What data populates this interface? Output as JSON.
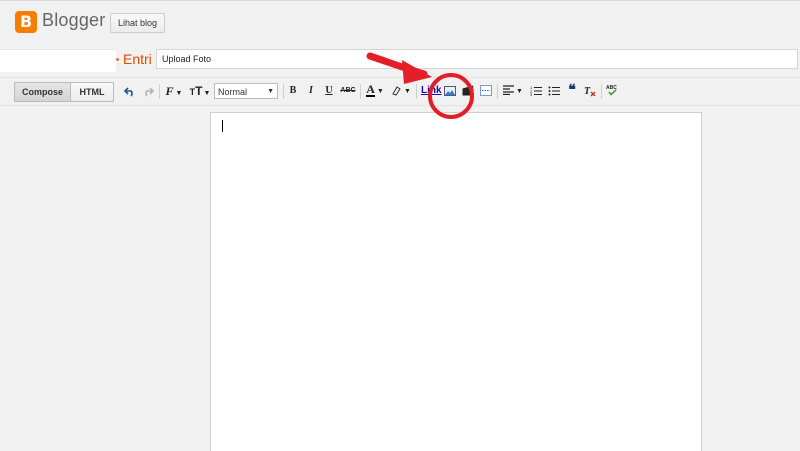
{
  "header": {
    "brand": "Blogger",
    "view_blog_button": "Lihat blog"
  },
  "post": {
    "section_label": "Entri",
    "title_value": "Upload Foto"
  },
  "toolbar": {
    "compose_label": "Compose",
    "html_label": "HTML",
    "format_value": "Normal",
    "link_label": "Link",
    "bold": "B",
    "italic": "I",
    "underline": "U",
    "strike": "ABC",
    "font_glyph": "F",
    "size_glyph": "T",
    "spell_label": "ABC"
  },
  "annotation": {
    "color": "#e41e26"
  }
}
